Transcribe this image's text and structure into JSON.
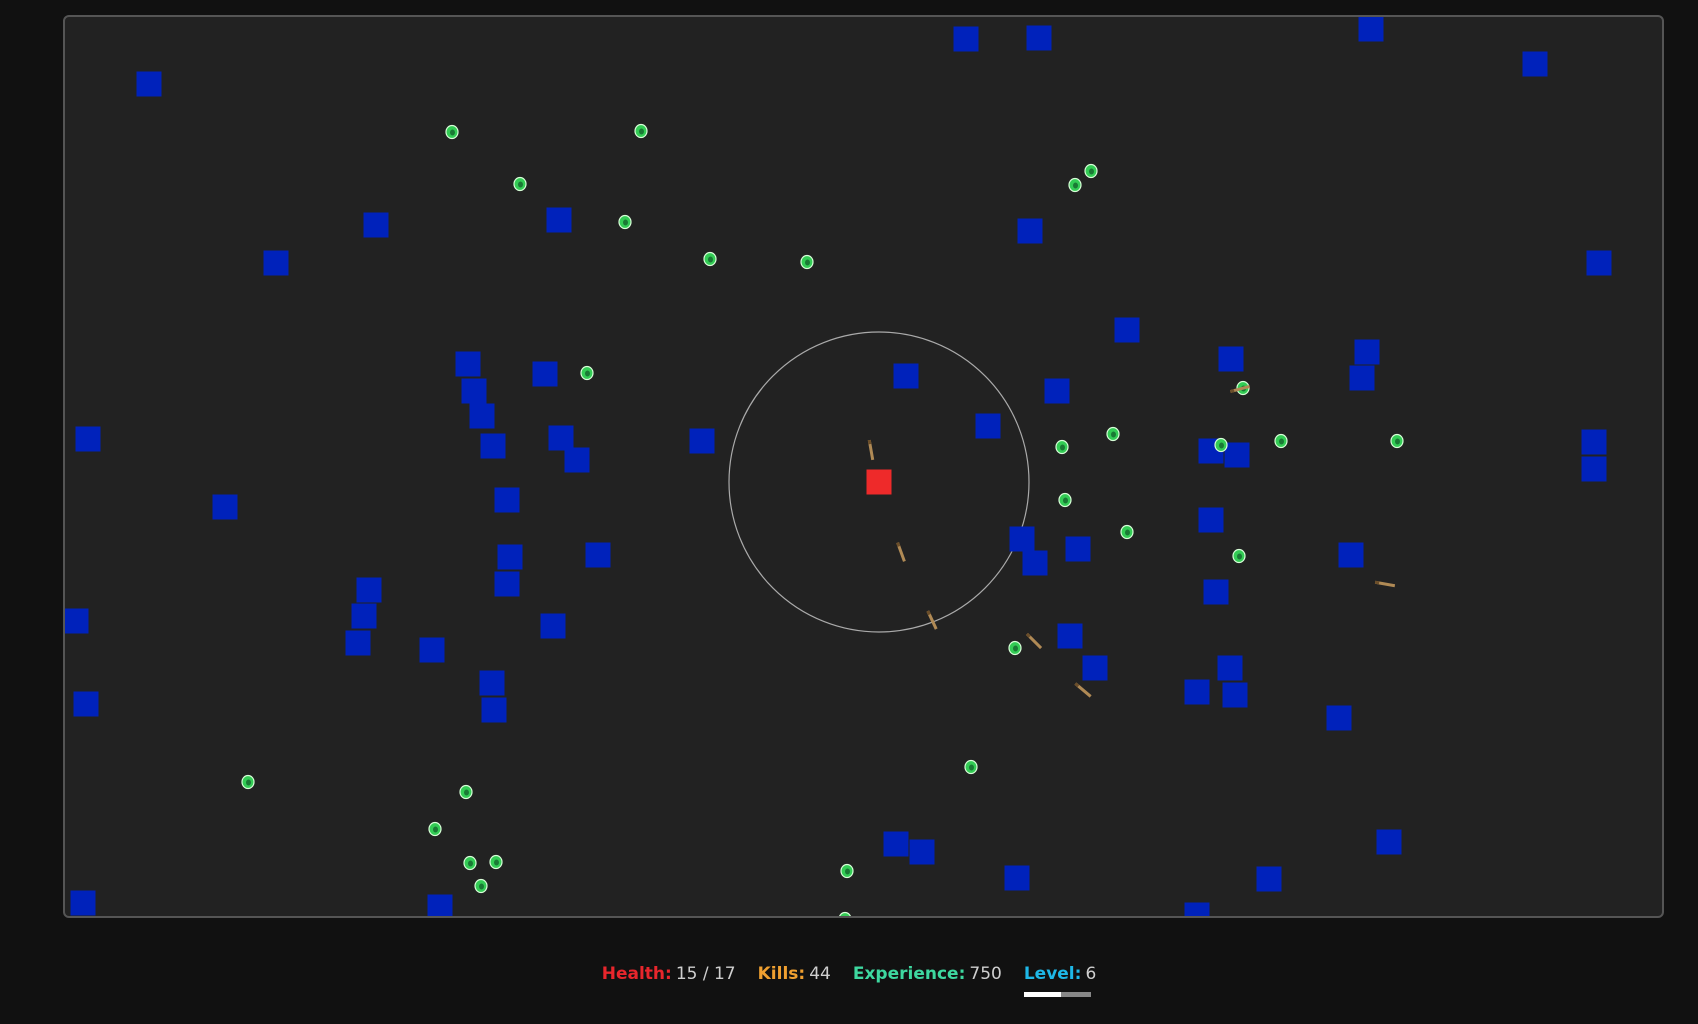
{
  "colors": {
    "background": "#111111",
    "arena": "#222222",
    "arena_border": "#555555",
    "player": "#ee2a2a",
    "enemy": "#0022bb",
    "gem": "#33cc55",
    "projectile": "#b08a55",
    "range_ring": "#aaaaaa",
    "health": "#e8262c",
    "kills": "#f0a030",
    "experience": "#3ed8a0",
    "level": "#1eb8e8"
  },
  "icons": {
    "player": "red-square",
    "enemy": "blue-square",
    "gem": "green-gem",
    "projectile": "dagger"
  },
  "hud": {
    "health_label": "Health:",
    "health_value": "15 / 17",
    "kills_label": "Kills:",
    "kills_value": "44",
    "experience_label": "Experience:",
    "experience_value": "750",
    "level_label": "Level:",
    "level_value": "6",
    "level_progress": 0.55
  }
}
